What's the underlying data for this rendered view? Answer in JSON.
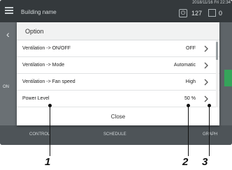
{
  "header": {
    "building_name": "Building name",
    "datetime": "2018/11/16 Fri 22:34",
    "count_a": "127",
    "count_b": "0"
  },
  "background": {
    "on_label": "ON",
    "bottom_tabs": [
      "CONTROL",
      "SCHEDULE",
      "GRAPH"
    ]
  },
  "modal": {
    "title": "Option",
    "rows": [
      {
        "label": "Ventilation -> ON/OFF",
        "value": "OFF"
      },
      {
        "label": "Ventilation -> Mode",
        "value": "Automatic"
      },
      {
        "label": "Ventilation -> Fan speed",
        "value": "High"
      },
      {
        "label": "Power Level",
        "value": "50 %"
      }
    ],
    "close_label": "Close"
  },
  "callouts": [
    "1",
    "2",
    "3"
  ],
  "icons": [
    "menu-icon",
    "power-icon",
    "device-box-icon",
    "chevron-right-icon",
    "chevron-left-icon"
  ]
}
